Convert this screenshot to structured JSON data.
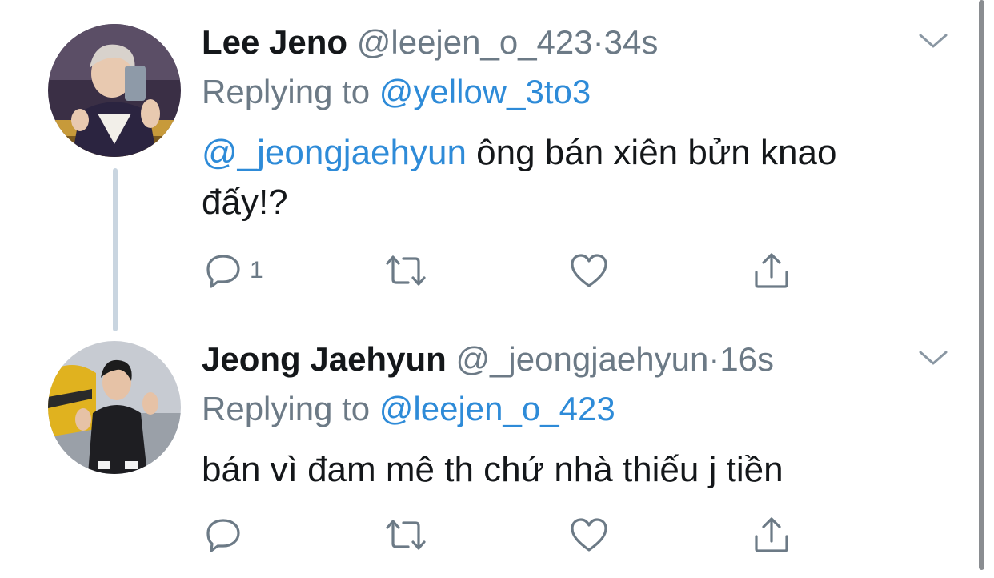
{
  "tweets": [
    {
      "name": "Lee Jeno",
      "handle": "@leejen_o_423",
      "separator": "·",
      "time": "34s",
      "replying_label": "Replying to",
      "replying_to": "@yellow_3to3",
      "text_mention": "@_jeongjaehyun",
      "text_line1": " ông bán xiên bửn knao",
      "text_line2": "đấy!?",
      "reply_count": "1"
    },
    {
      "name": "Jeong Jaehyun",
      "handle": "@_jeongjaehyun",
      "separator": "·",
      "time": "16s",
      "replying_label": "Replying to",
      "replying_to": "@leejen_o_423",
      "text": "bán vì đam mê th chứ nhà thiếu j tiền",
      "reply_count": ""
    }
  ],
  "icons": {
    "reply": "reply-icon",
    "retweet": "retweet-icon",
    "like": "heart-icon",
    "share": "share-icon",
    "more": "chevron-down-icon"
  },
  "colors": {
    "link": "#2e8bd8",
    "muted": "#6c7a86",
    "text": "#14171a",
    "thread_line": "#c9d5e0"
  }
}
